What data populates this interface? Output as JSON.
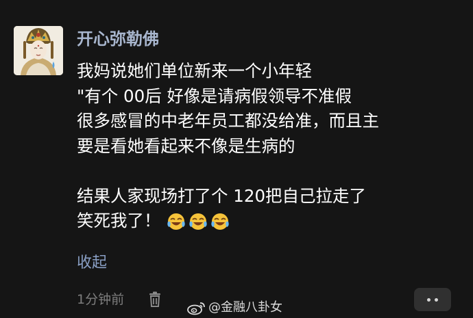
{
  "comment": {
    "username": "开心弥勒佛",
    "lines": [
      "我妈说她们单位新来一个小年轻",
      "\"有个 00后 好像是请病假领导不准假",
      "很多感冒的中老年员工都没给准，而且主",
      "要是看她看起来不像是生病的",
      "",
      "结果人家现场打了个 120把自己拉走了",
      "笑死我了！"
    ],
    "emojis": [
      "laughing-tears-emoji",
      "laughing-tears-emoji",
      "laughing-tears-emoji"
    ],
    "collapse_label": "收起",
    "timestamp": "1分钟前"
  },
  "icons": {
    "delete": "trash-icon",
    "more": "more-dots-icon",
    "watermark": "weibo-logo-icon"
  },
  "watermark": {
    "text": "@金融八卦女"
  },
  "colors": {
    "background": "#151515",
    "username": "#a8b6ce",
    "text": "#ffffff",
    "link": "#8aa0c5",
    "meta": "#7d7d7d"
  }
}
